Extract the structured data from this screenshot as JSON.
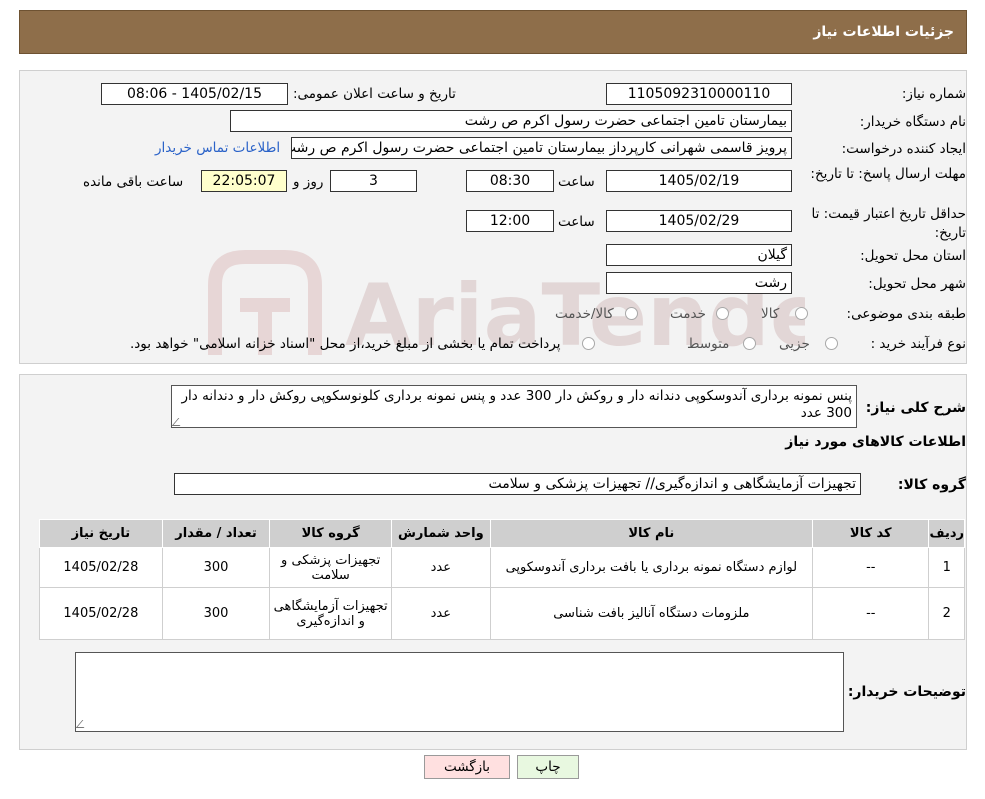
{
  "header": {
    "title": "جزئیات اطلاعات نیاز"
  },
  "form": {
    "need_number_label": "شماره نیاز:",
    "need_number": "1105092310000110",
    "announce_label": "تاریخ و ساعت اعلان عمومی:",
    "announce_value": "1405/02/15 - 08:06",
    "buyer_org_label": "نام دستگاه خریدار:",
    "buyer_org": "بیمارستان  تامین اجتماعی حضرت رسول اکرم ص رشت",
    "creator_label": "ایجاد کننده درخواست:",
    "creator": "پرویز قاسمی شهرانی کارپرداز بیمارستان  تامین اجتماعی حضرت رسول اکرم ص رشت",
    "contact_link": "اطلاعات تماس خریدار",
    "deadline_label": "مهلت ارسال پاسخ: تا تاریخ:",
    "deadline_date": "1405/02/19",
    "time_label": "ساعت",
    "deadline_time": "08:30",
    "days_value": "3",
    "days_label": "روز و",
    "remaining_time": "22:05:07",
    "remaining_label": "ساعت باقی مانده",
    "validity_label": "حداقل تاریخ اعتبار قیمت: تا تاریخ:",
    "validity_date": "1405/02/29",
    "validity_time": "12:00",
    "province_label": "استان محل تحویل:",
    "province": "گیلان",
    "city_label": "شهر محل تحویل:",
    "city": "رشت",
    "category_label": "طبقه بندی موضوعی:",
    "category_options": [
      "کالا",
      "خدمت",
      "کالا/خدمت"
    ],
    "process_label": "نوع فرآیند خرید :",
    "process_options": [
      "جزیی",
      "متوسط"
    ],
    "process_note": "پرداخت تمام یا بخشی از مبلغ خرید،از محل \"اسناد خزانه اسلامی\" خواهد بود."
  },
  "summary": {
    "label": "شرح کلی نیاز:",
    "text": "پنس نمونه برداری آندوسکوپی دندانه دار و روکش دار 300 عدد و پنس نمونه برداری کلونوسکوپی روکش دار و دندانه دار 300 عدد",
    "goods_info_title": "اطلاعات کالاهای مورد نیاز",
    "goods_group_label": "گروه کالا:",
    "goods_group": "تجهیزات آزمایشگاهی و اندازه‌گیری// تجهیزات پزشکی و سلامت"
  },
  "table": {
    "headers": [
      "ردیف",
      "کد کالا",
      "نام کالا",
      "واحد شمارش",
      "گروه کالا",
      "تعداد / مقدار",
      "تاریخ نیاز"
    ],
    "rows": [
      {
        "row": "1",
        "code": "--",
        "name": "لوازم دستگاه نمونه برداری یا بافت برداری آندوسکوپی",
        "unit": "عدد",
        "group": "تجهیزات پزشکی و سلامت",
        "qty": "300",
        "date": "1405/02/28"
      },
      {
        "row": "2",
        "code": "--",
        "name": "ملزومات دستگاه آنالیز بافت شناسی",
        "unit": "عدد",
        "group": "تجهیزات آزمایشگاهی و اندازه‌گیری",
        "qty": "300",
        "date": "1405/02/28"
      }
    ]
  },
  "buyer_notes": {
    "label": "توضیحات خریدار:",
    "text": ""
  },
  "buttons": {
    "print": "چاپ",
    "back": "بازگشت"
  },
  "watermark": {
    "text": "AriaTender.neT"
  },
  "colors": {
    "header": "#8e6e4a",
    "panel": "#f3f3f3",
    "link": "#2a62c8",
    "yellow_field": "#ffffcc",
    "back_button": "#ffe0e0",
    "print_button": "#e8f8e0"
  }
}
